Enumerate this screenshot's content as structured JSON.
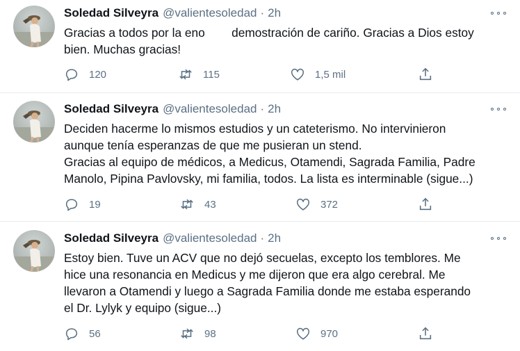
{
  "tweets": [
    {
      "name": "Soledad Silveyra",
      "handle": "@valientesoledad",
      "dot": "·",
      "time": "2h",
      "text": "Gracias a todos por la eno        demostración de cariño. Gracias a Dios estoy\nbien. Muchas gracias!",
      "replies": "120",
      "retweets": "115",
      "likes": "1,5 mil"
    },
    {
      "name": "Soledad Silveyra",
      "handle": "@valientesoledad",
      "dot": "·",
      "time": "2h",
      "text": "Deciden hacerme lo mismos estudios y un cateterismo. No intervinieron\naunque tenía esperanzas de que me pusieran un stend.\nGracias al equipo de médicos, a Medicus, Otamendi, Sagrada Familia, Padre\nManolo, Pipina Pavlovsky, mi familia, todos. La lista es interminable (sigue...)",
      "replies": "19",
      "retweets": "43",
      "likes": "372"
    },
    {
      "name": "Soledad Silveyra",
      "handle": "@valientesoledad",
      "dot": "·",
      "time": "2h",
      "text": "Estoy bien. Tuve un ACV que no dejó secuelas, excepto los temblores. Me\nhice una resonancia en Medicus y me dijeron que era algo cerebral. Me\nllevaron a Otamendi y luego a Sagrada Familia donde me estaba esperando\nel Dr. Lylyk y equipo (sigue...)",
      "replies": "56",
      "retweets": "98",
      "likes": "970"
    }
  ],
  "colors": {
    "text": "#0f1419",
    "muted": "#5b7083",
    "divider": "#e6ecf0"
  },
  "icons": [
    "reply-icon",
    "retweet-icon",
    "like-icon",
    "share-icon",
    "more-icon"
  ]
}
